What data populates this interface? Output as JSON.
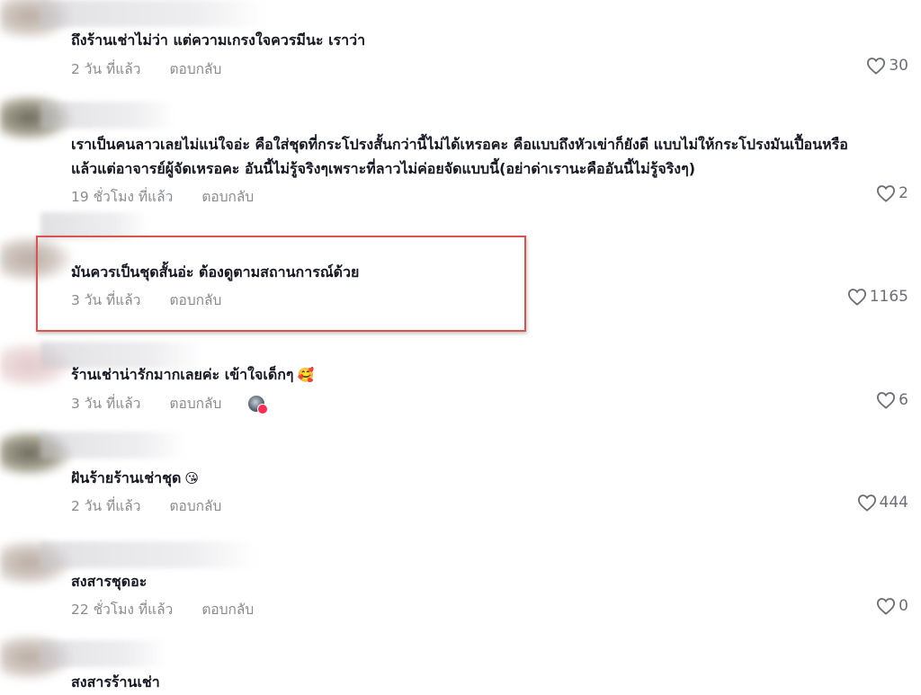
{
  "comments": [
    {
      "text_lines": [
        "ถึงร้านเช่าไม่ว่า แต่ความเกรงใจควรมีนะ เราว่า"
      ],
      "time": "2 วัน ที่แล้ว",
      "reply": "ตอบกลับ",
      "likes": "30"
    },
    {
      "text_lines": [
        "เราเป็นคนลาวเลยไม่แน่ใจอ่ะ คือใส่ชุดที่กระโปรงสั้นกว่านี้ไม่ได้เหรอคะ คือแบบถึงหัวเข่าก็ยังดี แบบไม่ให้กระโปรงมันเปื้อนหรือ",
        "แล้วแต่อาจารย์ผู้จัดเหรอคะ อันนี้ไม่รู้จริงๆเพราะที่ลาวไม่ค่อยจัดแบบนี้(อย่าด่าเรานะคืออันนี้ไม่รู้จริงๆ)"
      ],
      "time": "19 ชั่วโมง ที่แล้ว",
      "reply": "ตอบกลับ",
      "likes": "2"
    },
    {
      "text_lines": [
        "มันควรเป็นชุดสั้นอ่ะ ต้องดูตามสถานการณ์ด้วย"
      ],
      "time": "3 วัน ที่แล้ว",
      "reply": "ตอบกลับ",
      "likes": "1165"
    },
    {
      "text_lines": [
        "ร้านเช่าน่ารักมากเลยค่ะ เข้าใจเด็กๆ"
      ],
      "emoji": "🥰",
      "time": "3 วัน ที่แล้ว",
      "reply": "ตอบกลับ",
      "likes": "6"
    },
    {
      "text_lines": [
        "ฝันร้ายร้านเช่าชุด"
      ],
      "emoji": "😘",
      "time": "2 วัน ที่แล้ว",
      "reply": "ตอบกลับ",
      "likes": "444"
    },
    {
      "text_lines": [
        "สงสารชุดอะ"
      ],
      "time": "22 ชั่วโมง ที่แล้ว",
      "reply": "ตอบกลับ",
      "likes": "0"
    },
    {
      "text_lines": [
        "สงสารร้านเช่า"
      ]
    }
  ],
  "colors": {
    "text": "#161823",
    "meta": "#8a8b91",
    "highlight": "#d9534f",
    "liked_by_creator_badge": "#fe2c55"
  },
  "icons": {
    "like": "heart-outline-icon",
    "creator_liked": "creator-avatar-heart-icon"
  }
}
